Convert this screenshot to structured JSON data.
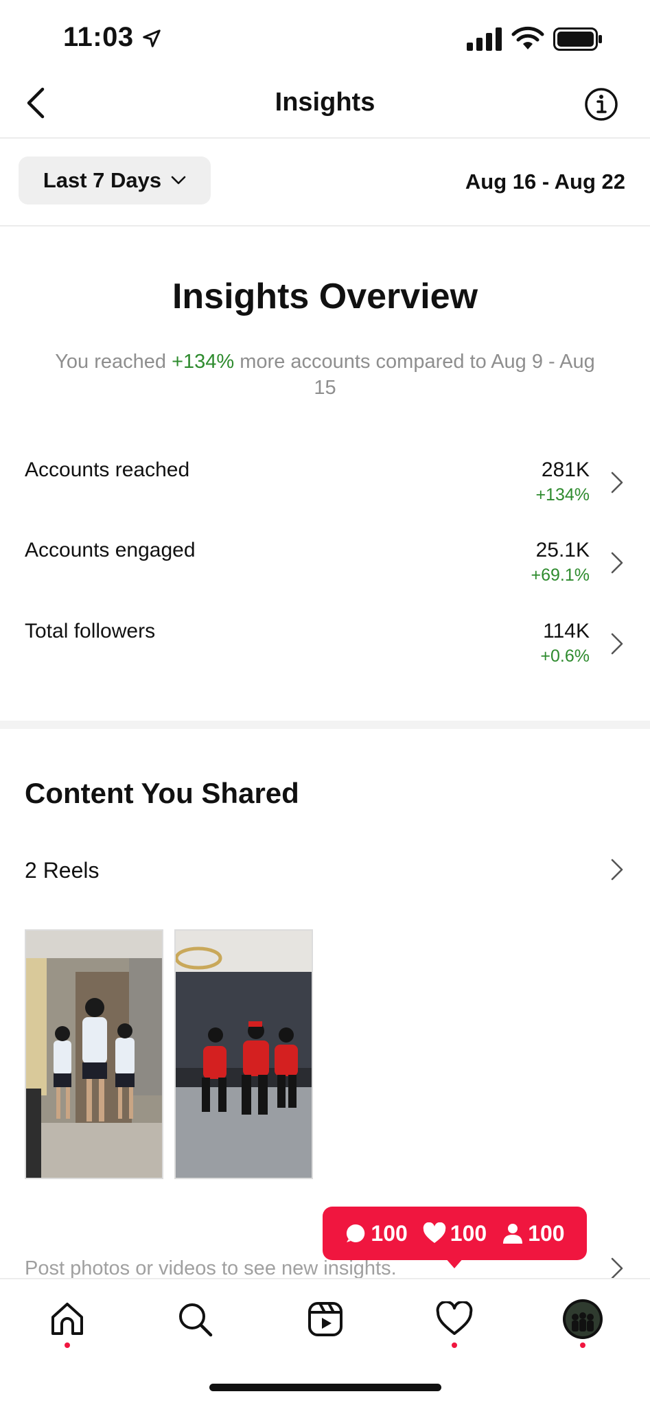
{
  "status_bar": {
    "time": "11:03"
  },
  "header": {
    "title": "Insights"
  },
  "filter": {
    "range_label": "Last 7 Days",
    "date_range": "Aug 16 - Aug 22"
  },
  "overview": {
    "title": "Insights Overview",
    "subtitle_prefix": "You reached ",
    "subtitle_highlight": "+134%",
    "subtitle_suffix": " more accounts compared to Aug 9 - Aug 15",
    "metrics": [
      {
        "label": "Accounts reached",
        "value": "281K",
        "delta": "+134%"
      },
      {
        "label": "Accounts engaged",
        "value": "25.1K",
        "delta": "+69.1%"
      },
      {
        "label": "Total followers",
        "value": "114K",
        "delta": "+0.6%"
      }
    ]
  },
  "content": {
    "title": "Content You Shared",
    "reels_label": "2 Reels",
    "hint": "Post photos or videos to see new insights."
  },
  "activity_badge": {
    "comments": "100",
    "likes": "100",
    "followers": "100"
  },
  "colors": {
    "accent_red": "#f0163f",
    "positive_green": "#2e8b2e"
  },
  "tabbar": [
    "home-icon",
    "search-icon",
    "reels-icon",
    "heart-icon",
    "profile-avatar"
  ]
}
